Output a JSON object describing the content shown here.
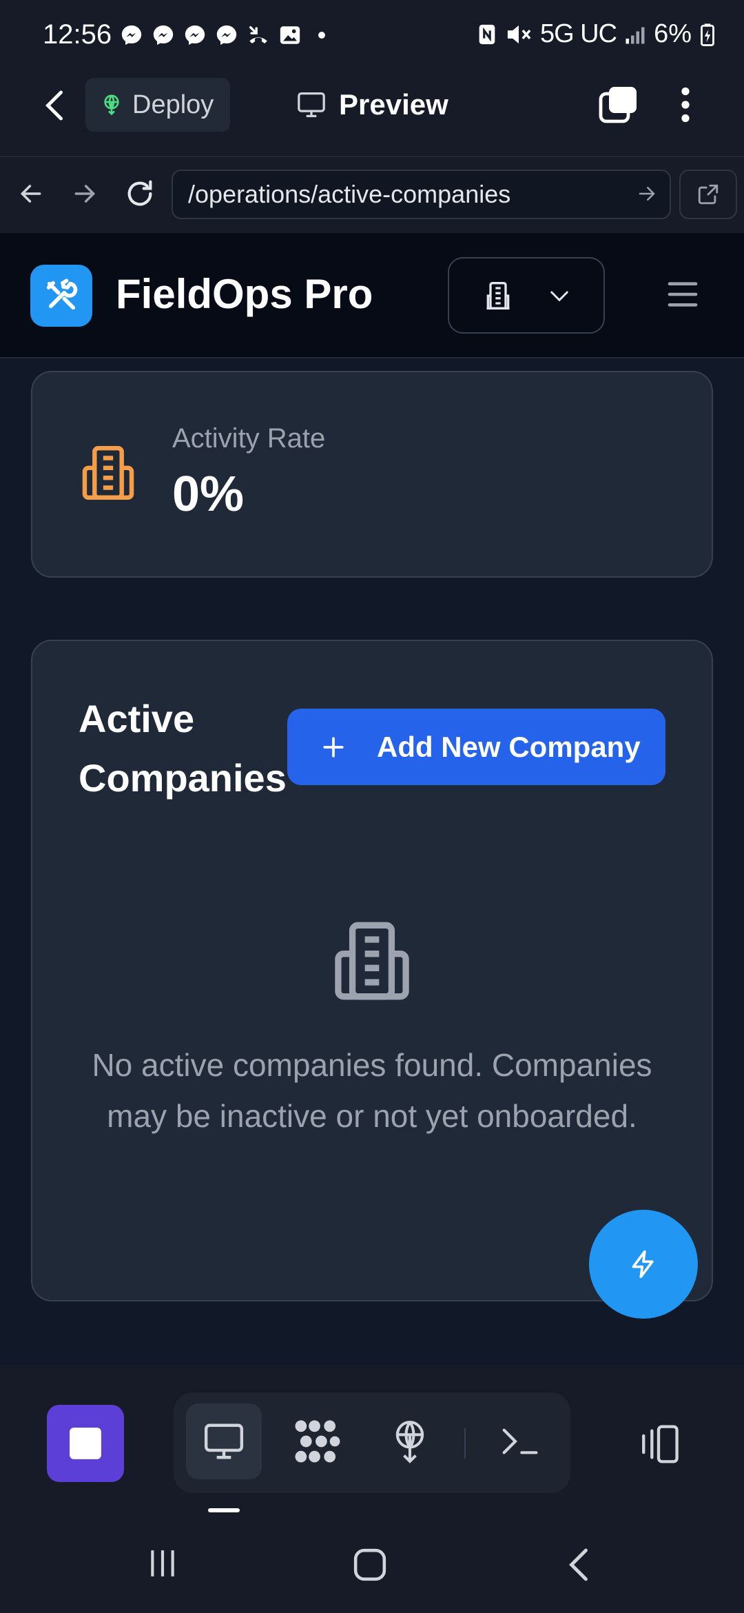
{
  "status_bar": {
    "time": "12:56",
    "network": "5G UC",
    "battery": "6%"
  },
  "toolbar": {
    "deploy_label": "Deploy",
    "preview_label": "Preview"
  },
  "browser": {
    "url": "/operations/active-companies"
  },
  "app": {
    "name": "FieldOps Pro"
  },
  "stats": {
    "activity_rate_label": "Activity Rate",
    "activity_rate_value": "0%"
  },
  "companies": {
    "title": "Active Companies",
    "add_button_label": "Add New Company",
    "empty_message": "No active companies found. Companies may be inactive or not yet onboarded."
  },
  "colors": {
    "primary": "#2563eb",
    "accent_blue": "#2196f3",
    "warning_orange": "#f59e4a",
    "card_bg": "#1f2937",
    "page_bg": "#111827"
  }
}
